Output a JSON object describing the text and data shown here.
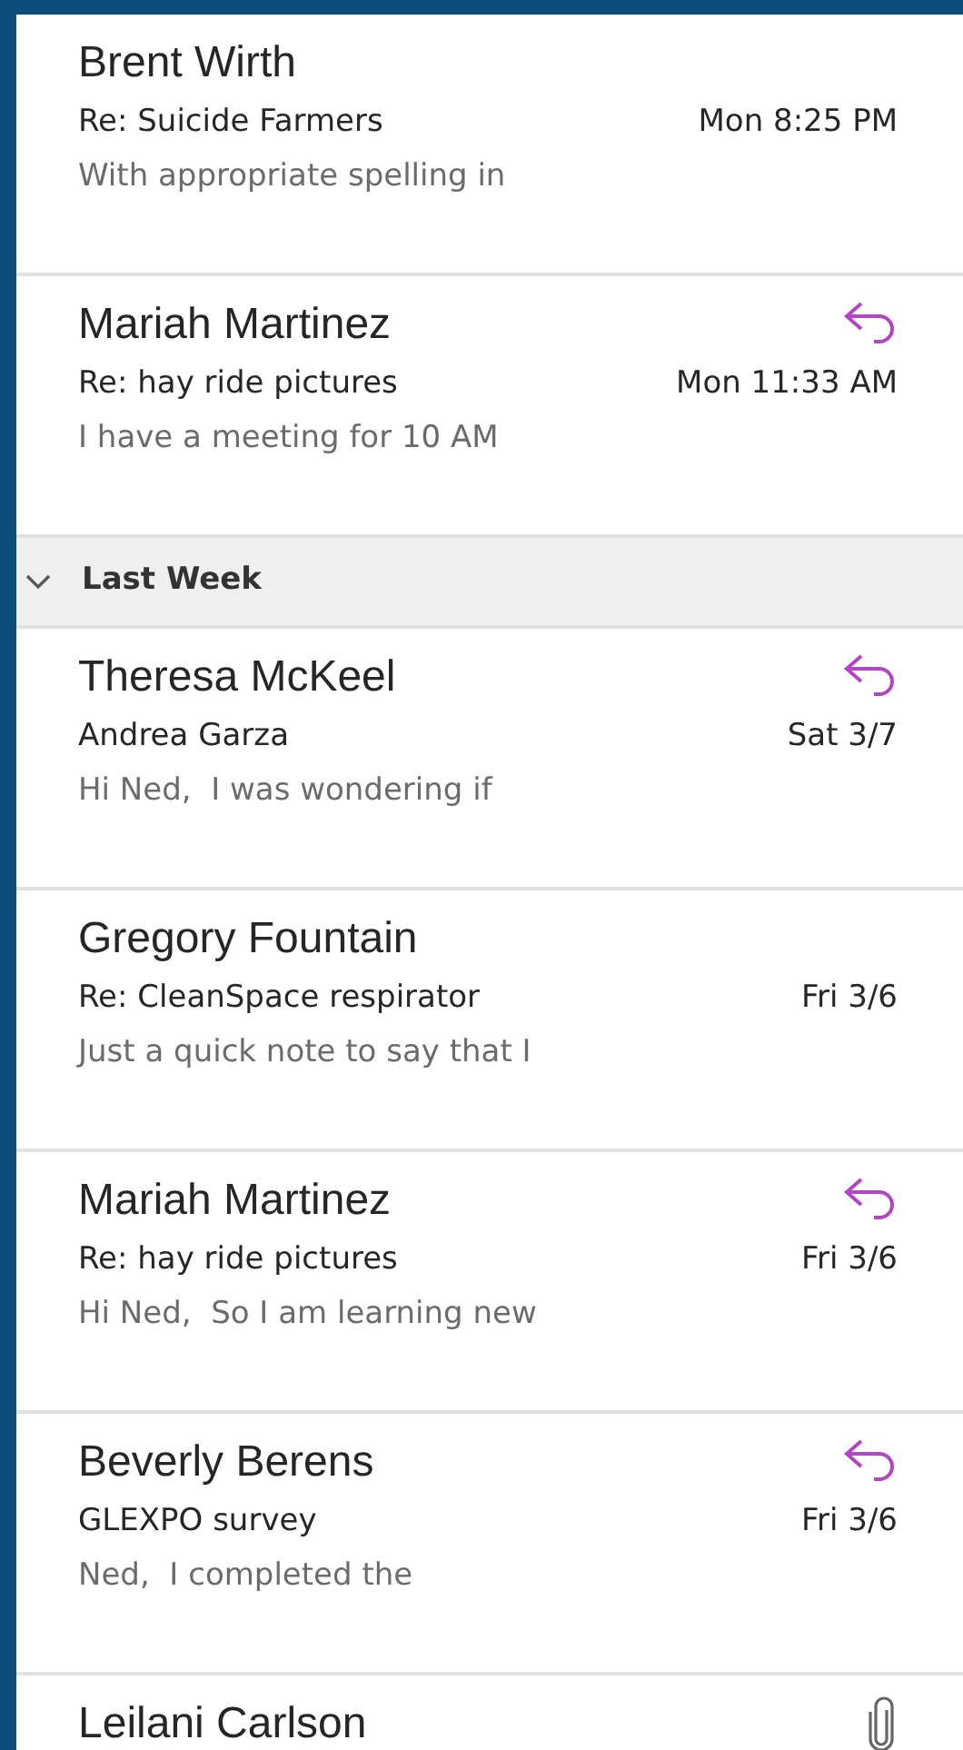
{
  "sections": [
    {
      "items": [
        {
          "sender": "Brent Wirth",
          "subject": "Re: Suicide Farmers",
          "time": "Mon 8:25 PM",
          "preview": "With appropriate spelling in",
          "replied": false,
          "attachment": false
        },
        {
          "sender": "Mariah Martinez",
          "subject": "Re: hay ride pictures",
          "time": "Mon 11:33 AM",
          "preview": "I have a meeting for 10 AM",
          "replied": true,
          "attachment": false
        }
      ]
    },
    {
      "header": "Last Week",
      "expanded": true,
      "items": [
        {
          "sender": "Theresa McKeel",
          "subject": "Andrea Garza",
          "time": "Sat 3/7",
          "preview": "Hi Ned,  I was wondering if",
          "replied": true,
          "attachment": false
        },
        {
          "sender": "Gregory Fountain",
          "subject": "Re: CleanSpace respirator",
          "time": "Fri 3/6",
          "preview": "Just a quick note to say that I",
          "replied": false,
          "attachment": false
        },
        {
          "sender": "Mariah Martinez",
          "subject": "Re: hay ride pictures",
          "time": "Fri 3/6",
          "preview": "Hi Ned,  So I am learning new",
          "replied": true,
          "attachment": false
        },
        {
          "sender": "Beverly Berens",
          "subject": "GLEXPO survey",
          "time": "Fri 3/6",
          "preview": "Ned,  I completed the",
          "replied": true,
          "attachment": false
        },
        {
          "sender": "Leilani Carlson",
          "replied": false,
          "attachment": true
        }
      ]
    }
  ]
}
